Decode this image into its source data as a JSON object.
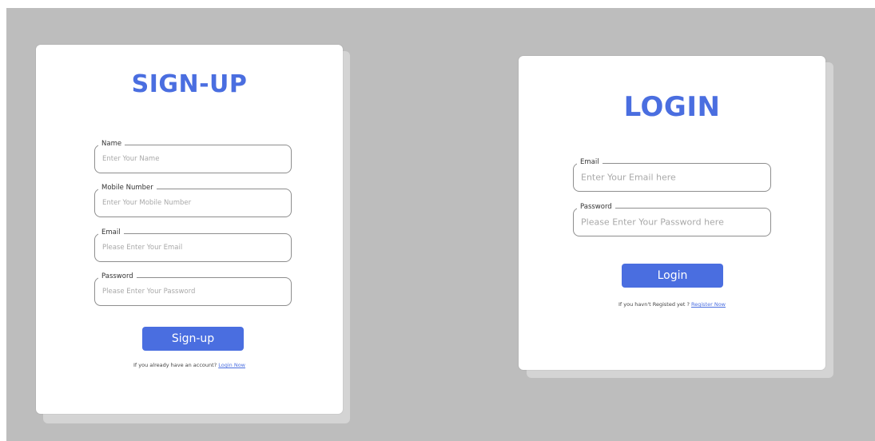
{
  "colors": {
    "accent": "#4a6ee0",
    "backdrop": "#bdbdbd",
    "card": "#ffffff",
    "card_shadow": "#d4d4d4",
    "field_border": "#8e8e8e"
  },
  "signup": {
    "title": "SIGN-UP",
    "fields": [
      {
        "label": "Name",
        "placeholder": "Enter Your Name"
      },
      {
        "label": "Mobile Number",
        "placeholder": "Enter Your Mobile Number"
      },
      {
        "label": "Email",
        "placeholder": "Please Enter Your Email"
      },
      {
        "label": "Password",
        "placeholder": "Please Enter Your Password"
      }
    ],
    "button_label": "Sign-up",
    "footer_text": "If you already have an account?",
    "footer_link": "Login Now"
  },
  "login": {
    "title": "LOGIN",
    "fields": [
      {
        "label": "Email",
        "placeholder": "Enter Your Email here"
      },
      {
        "label": "Password",
        "placeholder": "Please Enter Your Password here"
      }
    ],
    "button_label": "Login",
    "footer_text": "If you havn't Registed yet ?",
    "footer_link": "Register Now"
  }
}
